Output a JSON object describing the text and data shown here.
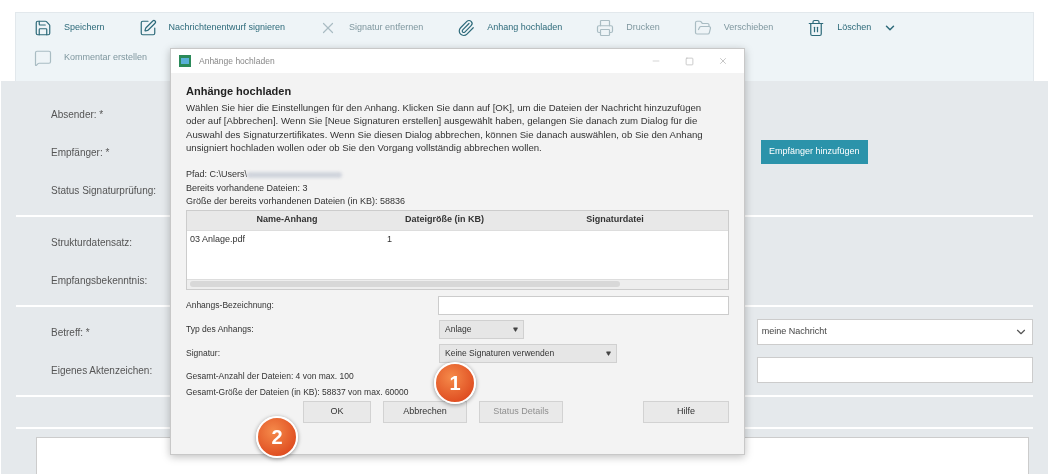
{
  "toolbar": {
    "items": [
      {
        "kind": "save",
        "label": "Speichern",
        "disabled": false
      },
      {
        "kind": "sign",
        "label": "Nachrichtenentwurf signieren",
        "disabled": false
      },
      {
        "kind": "remove",
        "label": "Signatur entfernen",
        "disabled": true
      },
      {
        "kind": "attach",
        "label": "Anhang hochladen",
        "disabled": false
      },
      {
        "kind": "print",
        "label": "Drucken",
        "disabled": true
      },
      {
        "kind": "move",
        "label": "Verschieben",
        "disabled": true
      },
      {
        "kind": "delete",
        "label": "Löschen",
        "disabled": false,
        "dropdown": true
      }
    ],
    "second_row": [
      {
        "kind": "comment",
        "label": "Kommentar erstellen",
        "disabled": true
      }
    ]
  },
  "form": {
    "sections": [
      {
        "rows": [
          {
            "label": "Absender: *"
          },
          {
            "label": "Empfänger: *",
            "button": "Empfänger hinzufügen"
          },
          {
            "label": "Status Signaturprüfung:"
          }
        ]
      },
      {
        "rows": [
          {
            "label": "Strukturdatensatz:"
          },
          {
            "label": "Empfangsbekenntnis:"
          }
        ]
      },
      {
        "rows": [
          {
            "label": "Betreff: *",
            "select": "meine Nachricht"
          },
          {
            "label": "Eigenes Aktenzeichen:",
            "input": true
          }
        ]
      }
    ]
  },
  "dialog": {
    "title": "Anhänge hochladen",
    "heading": "Anhänge hochladen",
    "description": "Wählen Sie hier die Einstellungen für den Anhang. Klicken Sie dann auf [OK], um die Dateien der Nachricht hinzuzufügen oder auf [Abbrechen]. Wenn Sie [Neue Signaturen erstellen] ausgewählt haben, gelangen Sie danach zum Dialog für die Auswahl des Signaturzertifikates. Wenn Sie diesen Dialog abbrechen, können Sie danach auswählen, ob Sie den Anhang unsigniert hochladen wollen oder ob Sie den Vorgang vollständig abbrechen wollen.",
    "path": "Pfad: C:\\Users\\",
    "info": [
      "Bereits vorhandene Dateien: 3",
      "Größe der bereits vorhandenen Dateien (in KB): 58836"
    ],
    "table": {
      "columns": [
        "Name-Anhang",
        "Dateigröße (in KB)",
        "Signaturdatei"
      ],
      "rows": [
        [
          "03 Anlage.pdf",
          "1",
          ""
        ]
      ]
    },
    "fields": [
      {
        "kind": "input",
        "label": "Anhangs-Bezeichnung:"
      },
      {
        "kind": "select",
        "label": "Typ des Anhangs:",
        "value": "Anlage"
      },
      {
        "kind": "select",
        "label": "Signatur:",
        "value": "Keine Signaturen verwenden"
      }
    ],
    "totals": [
      "Gesamt-Anzahl der Dateien: 4 von max. 100",
      "Gesamt-Größe der Dateien (in KB): 58837 von max. 60000"
    ],
    "buttons": [
      {
        "label": "OK",
        "disabled": false
      },
      {
        "label": "Abbrechen",
        "disabled": false
      },
      {
        "label": "Status Details",
        "disabled": true
      },
      {
        "label": "Hilfe",
        "disabled": false
      }
    ]
  },
  "markers": [
    "1",
    "2"
  ]
}
